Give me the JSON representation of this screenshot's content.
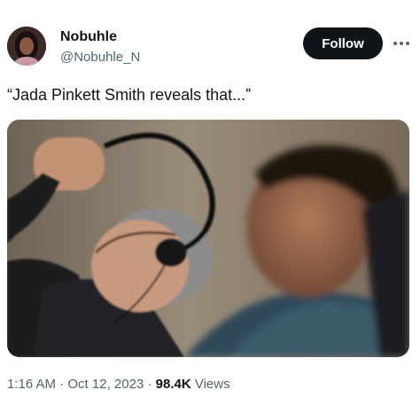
{
  "user": {
    "display_name": "Nobuhle",
    "handle": "@Nobuhle_N"
  },
  "actions": {
    "follow_label": "Follow",
    "more_icon": "more-horizontal-icon"
  },
  "tweet": {
    "text": "“Jada Pinkett Smith reveals that...”"
  },
  "meta": {
    "time": "1:16 AM",
    "separator1": " · ",
    "date": "Oct 12, 2023",
    "separator2": " · ",
    "views_count": "98.4K",
    "views_label": " Views"
  },
  "colors": {
    "text_primary": "#0f1419",
    "text_secondary": "#536471",
    "follow_bg": "#0f1419",
    "follow_text": "#ffffff"
  }
}
